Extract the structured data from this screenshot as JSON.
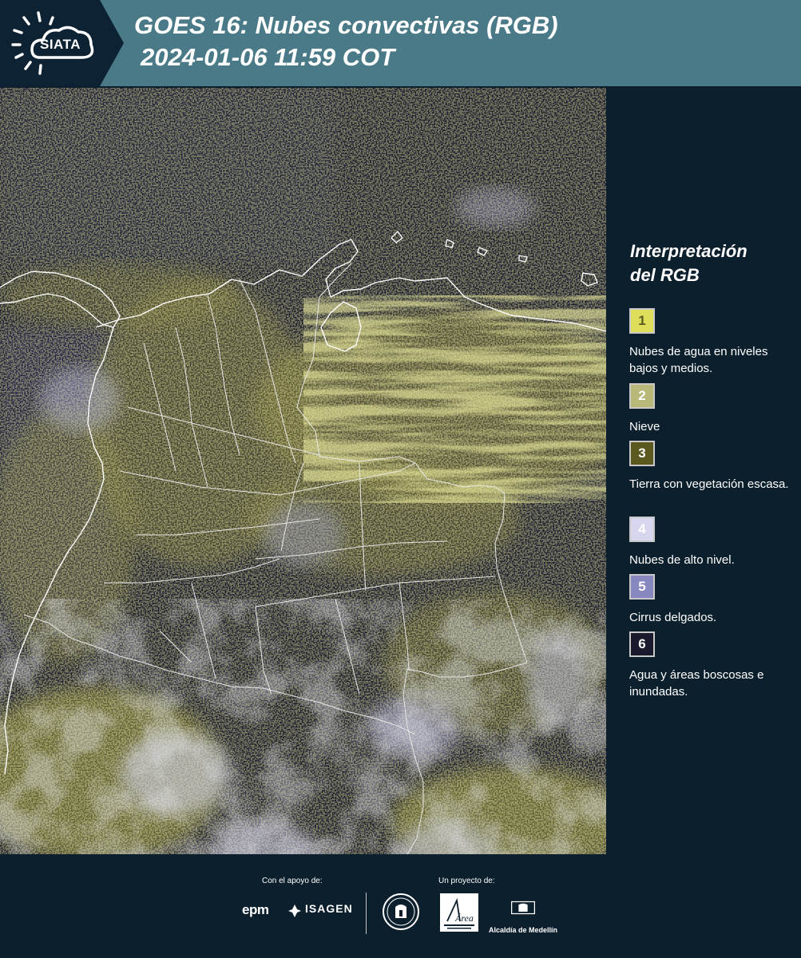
{
  "header": {
    "logo_text": "SIATA",
    "title_line1": "GOES 16: Nubes convectivas (RGB)",
    "title_line2": "2024-01-06 11:59 COT"
  },
  "legend": {
    "title_line1": "Interpretación",
    "title_line2": "del RGB",
    "items": [
      {
        "number": "1",
        "label": "Nubes de agua en niveles bajos y medios.",
        "color": "#dede5a",
        "text_color": "#5a5a20"
      },
      {
        "number": "2",
        "label": "Nieve",
        "color": "#b8b878",
        "text_color": "#ffffff"
      },
      {
        "number": "3",
        "label": "Tierra con vegetación escasa.",
        "color": "#5a5a20",
        "text_color": "#ffffff"
      },
      {
        "number": "4",
        "label": "Nubes de alto nivel.",
        "color": "#d6d6ee",
        "text_color": "#ffffff"
      },
      {
        "number": "5",
        "label": "Cirrus delgados.",
        "color": "#8888c0",
        "text_color": "#ffffff"
      },
      {
        "number": "6",
        "label": "Agua y áreas boscosas e inundadas.",
        "color": "#1a1a2e",
        "text_color": "#ffffff"
      }
    ]
  },
  "footer": {
    "support_caption": "Con el apoyo de:",
    "project_caption": "Un proyecto de:",
    "sponsors": [
      "epm",
      "ISAGEN"
    ],
    "partner": "Alcaldía de Medellín",
    "area_logo_text": "Área"
  },
  "colors": {
    "header_bg": "#4a7a87",
    "panel_bg": "#0c1f2c",
    "map_dark": "#1c1c30",
    "cloud_yellow": "#dede5a",
    "high_cloud": "#d6d6ee",
    "border_line": "#ffffff"
  }
}
